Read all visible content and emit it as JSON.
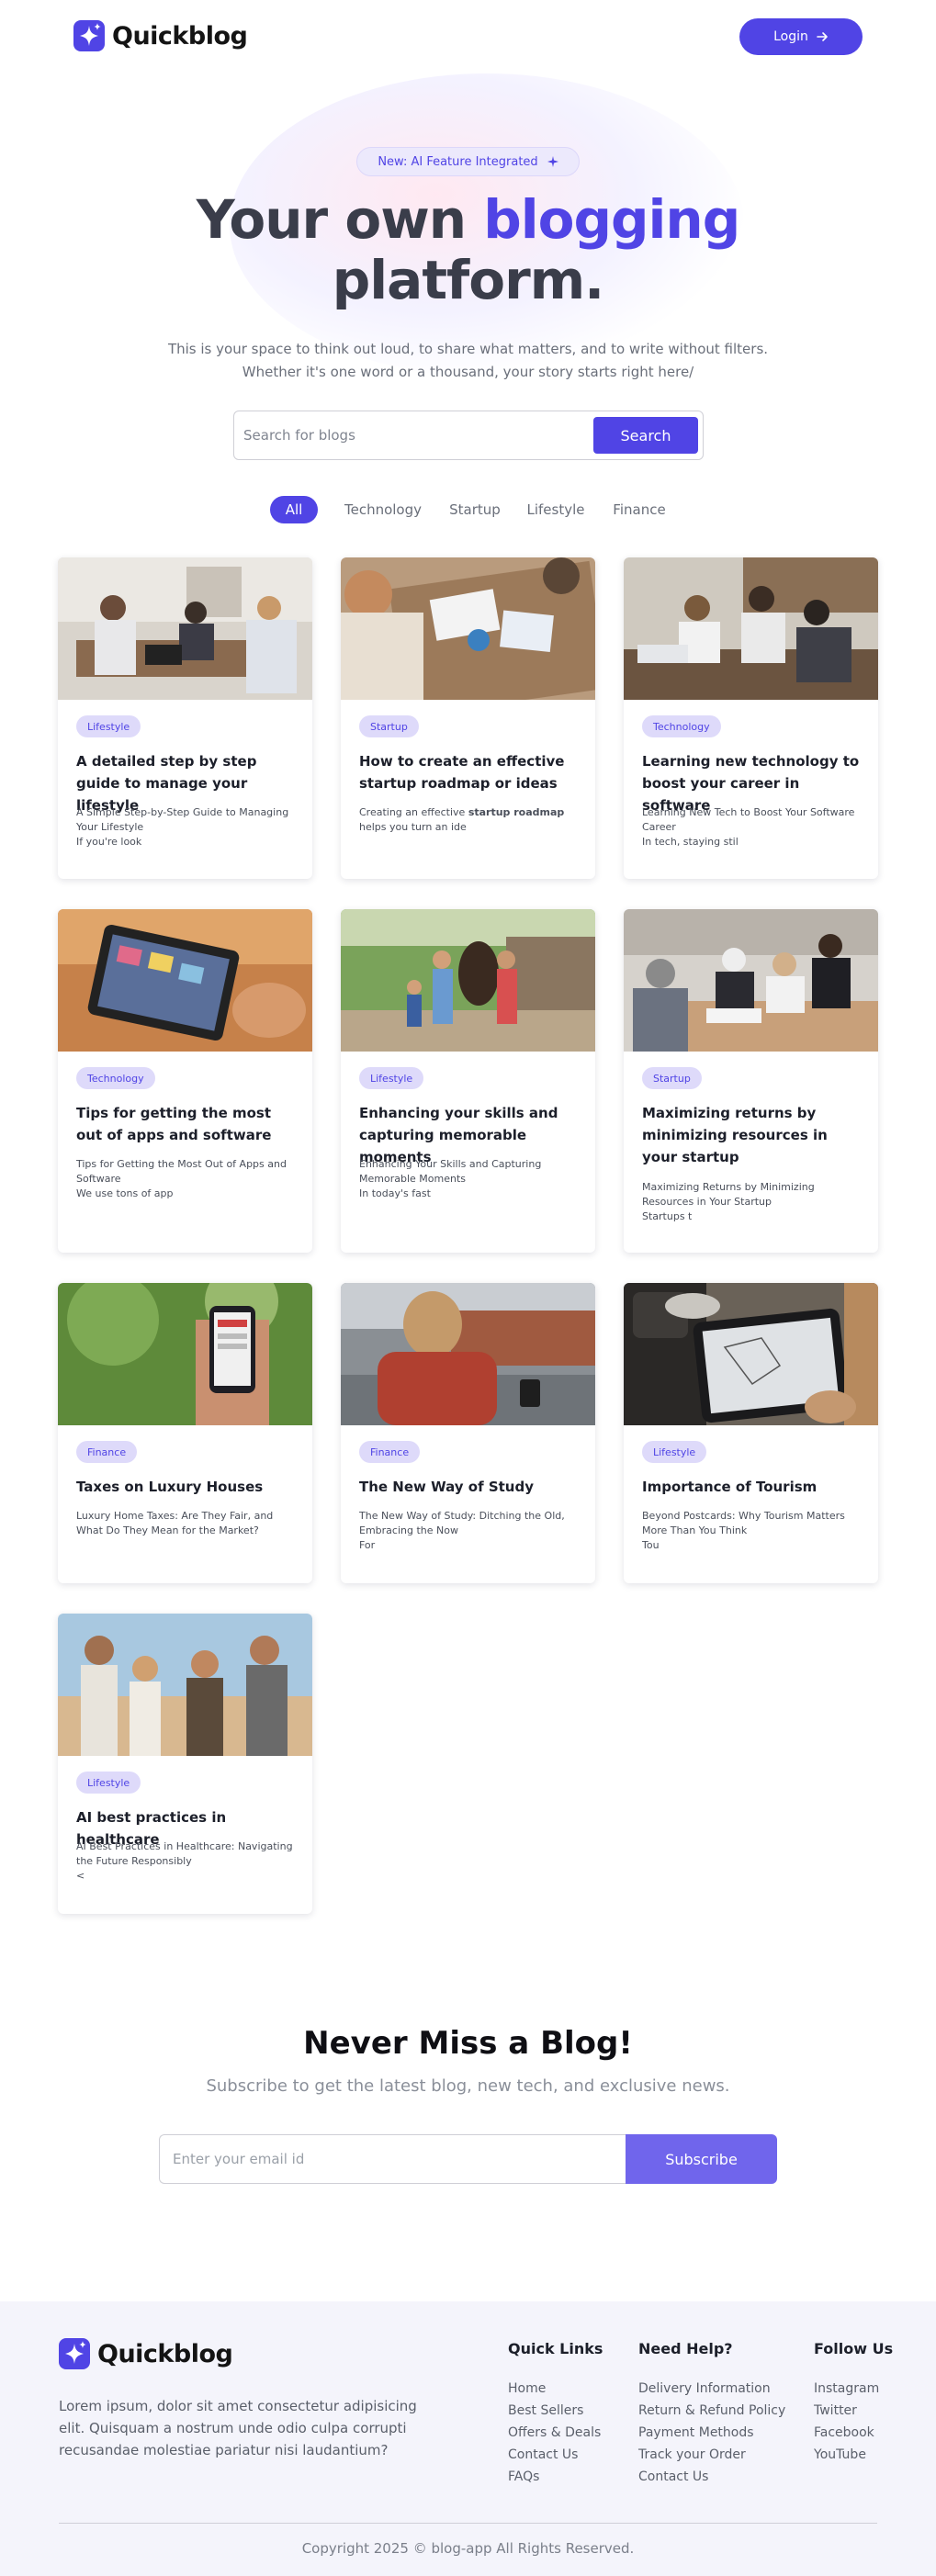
{
  "brand": {
    "name": "Quickblog"
  },
  "nav": {
    "login_label": "Login"
  },
  "hero": {
    "badge": "New: AI Feature Integrated",
    "title_part1": "Your own ",
    "title_accent": "blogging",
    "title_part2": "platform.",
    "subtitle": "This is your space to think out loud, to share what matters, and to write without filters. Whether it's one word or a thousand, your story starts right here/"
  },
  "search": {
    "placeholder": "Search for blogs",
    "button_label": "Search"
  },
  "categories": [
    "All",
    "Technology",
    "Startup",
    "Lifestyle",
    "Finance"
  ],
  "active_category": "All",
  "blogs": [
    {
      "tag": "Lifestyle",
      "title": "A detailed step by step guide to manage your lifestyle",
      "desc": "A Simple Step-by-Step Guide to Managing Your Lifestyle\nIf you're look"
    },
    {
      "tag": "Startup",
      "title": "How to create an effective startup roadmap or ideas",
      "desc_pre": "Creating an effective ",
      "desc_bold": "startup roadmap",
      "desc_post": " helps you turn an ide"
    },
    {
      "tag": "Technology",
      "title": "Learning new technology to boost your career in software",
      "desc": "Learning New Tech to Boost Your Software Career\nIn tech, staying stil"
    },
    {
      "tag": "Technology",
      "title": "Tips for getting the most out of apps and software",
      "desc": "Tips for Getting the Most Out of Apps and Software\nWe use tons of app"
    },
    {
      "tag": "Lifestyle",
      "title": "Enhancing your skills and capturing memorable moments",
      "desc": "Enhancing Your Skills and Capturing Memorable Moments\nIn today's fast"
    },
    {
      "tag": "Startup",
      "title": "Maximizing returns by minimizing resources in your startup",
      "desc": "Maximizing Returns by Minimizing Resources in Your Startup\nStartups t"
    },
    {
      "tag": "Finance",
      "title": "Taxes on Luxury Houses",
      "desc": "Luxury Home Taxes: Are They Fair, and What Do They Mean for the Market?"
    },
    {
      "tag": "Finance",
      "title": "The New Way of Study",
      "desc": "The New Way of Study: Ditching the Old, Embracing the Now\nFor"
    },
    {
      "tag": "Lifestyle",
      "title": "Importance of Tourism",
      "desc": "Beyond Postcards: Why Tourism Matters More Than You Think\nTou"
    },
    {
      "tag": "Lifestyle",
      "title": "AI best practices in healthcare",
      "desc": "AI Best Practices in Healthcare: Navigating the Future Responsibly\n<"
    }
  ],
  "newsletter": {
    "title": "Never Miss a Blog!",
    "subtitle": "Subscribe to get the latest blog, new tech, and exclusive news.",
    "placeholder": "Enter your email id",
    "button_label": "Subscribe"
  },
  "footer": {
    "about": "Lorem ipsum, dolor sit amet consectetur adipisicing elit. Quisquam a nostrum unde odio culpa corrupti recusandae molestiae pariatur nisi laudantium?",
    "columns": [
      {
        "title": "Quick Links",
        "links": [
          "Home",
          "Best Sellers",
          "Offers & Deals",
          "Contact Us",
          "FAQs"
        ]
      },
      {
        "title": "Need Help?",
        "links": [
          "Delivery Information",
          "Return & Refund Policy",
          "Payment Methods",
          "Track your Order",
          "Contact Us"
        ]
      },
      {
        "title": "Follow Us",
        "links": [
          "Instagram",
          "Twitter",
          "Facebook",
          "YouTube"
        ]
      }
    ],
    "copyright": "Copyright 2025 © blog-app All Rights Reserved."
  },
  "colors": {
    "primary": "#5044e5",
    "tag_bg": "#dedafa",
    "footer_bg": "#f4f4fb"
  },
  "icons": {
    "logo": "sparkle-star-icon",
    "login_arrow": "arrow-right-icon",
    "badge": "sparkle-icon"
  }
}
